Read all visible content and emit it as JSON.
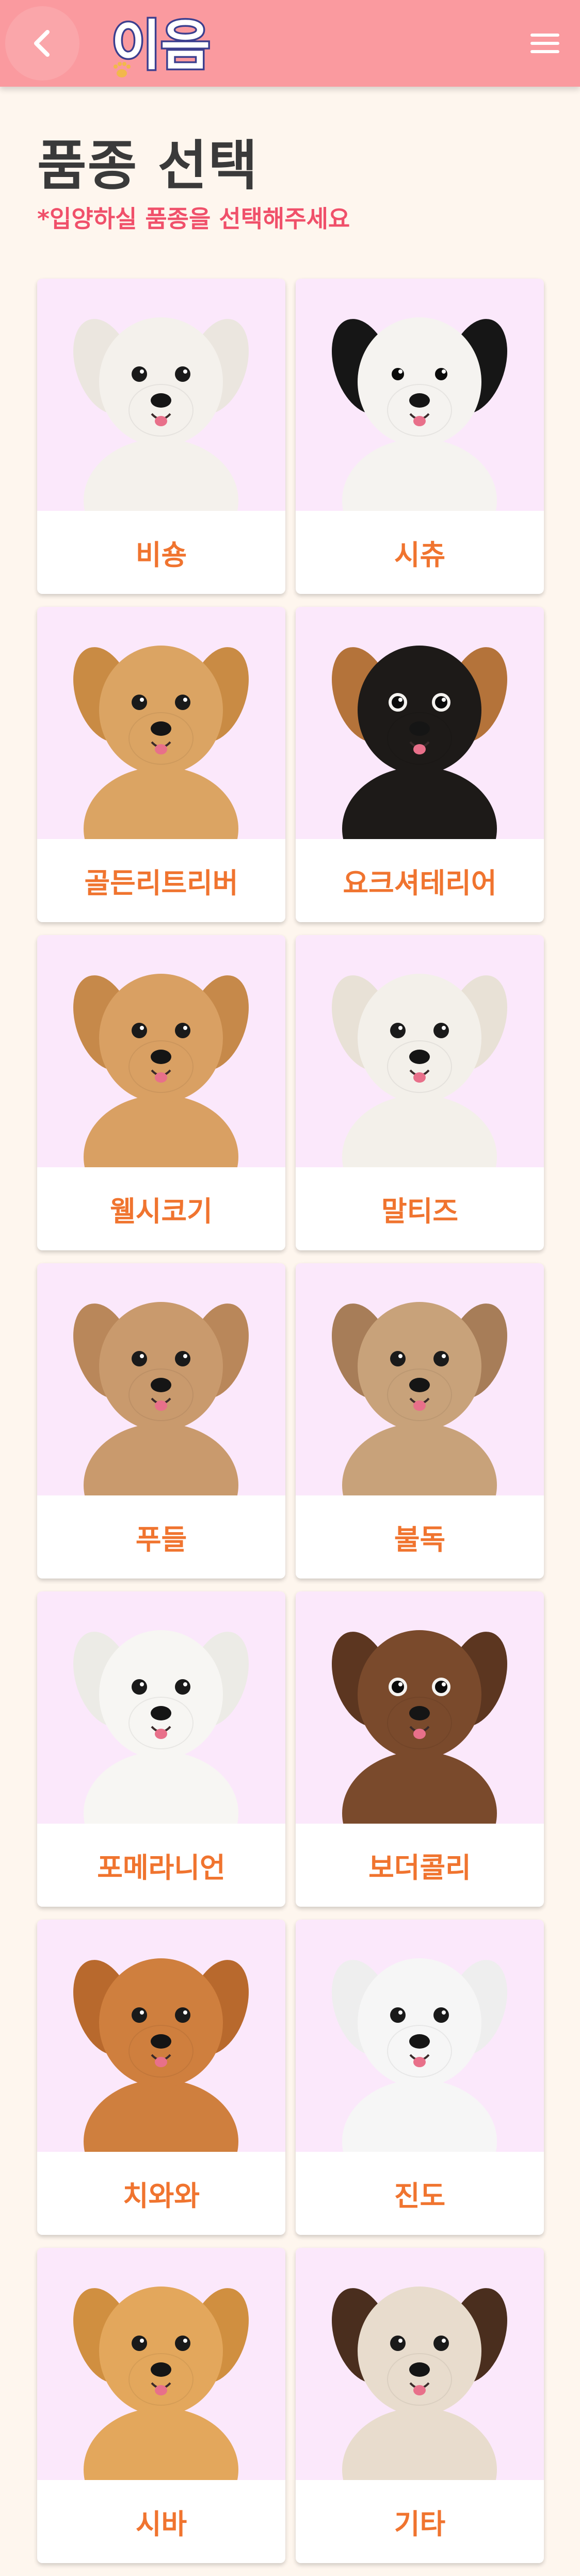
{
  "header": {
    "logo_text": "이음",
    "back_icon": "chevron-left-icon",
    "menu_icon": "hamburger-menu-icon"
  },
  "page": {
    "title": "품종 선택",
    "subtitle": "*입양하실 품종을 선택해주세요"
  },
  "colors": {
    "header_bg": "#fa9a9f",
    "page_bg": "#fef6ee",
    "card_image_bg": "#fbe8fb",
    "label_color": "#f0742f",
    "subtitle_color": "#f0506a"
  },
  "breeds": [
    {
      "label": "비숑",
      "coat": "#f4f1ec",
      "ear": "#ebe6df",
      "dark": false
    },
    {
      "label": "시츄",
      "coat": "#f5f3f0",
      "ear": "#161616",
      "dark": true
    },
    {
      "label": "골든리트리버",
      "coat": "#dba463",
      "ear": "#c98b44",
      "dark": false
    },
    {
      "label": "요크셔테리어",
      "coat": "#1d1a18",
      "ear": "#b4733a",
      "dark": true
    },
    {
      "label": "웰시코기",
      "coat": "#d9a063",
      "ear": "#c6894a",
      "dark": false
    },
    {
      "label": "말티즈",
      "coat": "#f3f0ea",
      "ear": "#e8e1d6",
      "dark": false
    },
    {
      "label": "푸들",
      "coat": "#c99a6d",
      "ear": "#b9875a",
      "dark": false
    },
    {
      "label": "불독",
      "coat": "#c8a27a",
      "ear": "#a77d58",
      "dark": false
    },
    {
      "label": "포메라니언",
      "coat": "#f7f6f3",
      "ear": "#ecebe6",
      "dark": false
    },
    {
      "label": "보더콜리",
      "coat": "#7a4a2c",
      "ear": "#5c3620",
      "dark": true
    },
    {
      "label": "치와와",
      "coat": "#cf7f3e",
      "ear": "#b8692d",
      "dark": false
    },
    {
      "label": "진도",
      "coat": "#f6f6f6",
      "ear": "#eeeeee",
      "dark": false
    },
    {
      "label": "시바",
      "coat": "#e3a75c",
      "ear": "#d08f40",
      "dark": false
    },
    {
      "label": "기타",
      "coat": "#e8dccd",
      "ear": "#4a2e1e",
      "dark": false
    }
  ]
}
